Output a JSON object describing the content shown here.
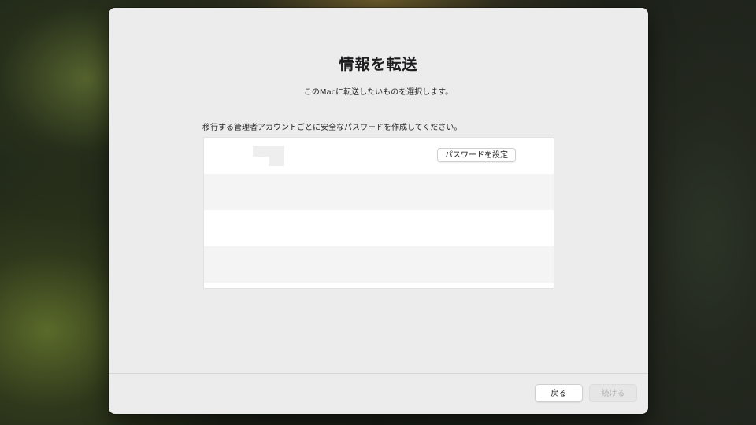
{
  "window": {
    "title": "情報を転送",
    "subtitle": "このMacに転送したいものを選択します。",
    "instruction": "移行する管理者アカウントごとに安全なパスワードを作成してください。"
  },
  "accounts": {
    "rows": [
      {
        "set_password_label": "パスワードを設定"
      }
    ]
  },
  "footer": {
    "back_label": "戻る",
    "continue_label": "続ける",
    "continue_enabled": false
  }
}
